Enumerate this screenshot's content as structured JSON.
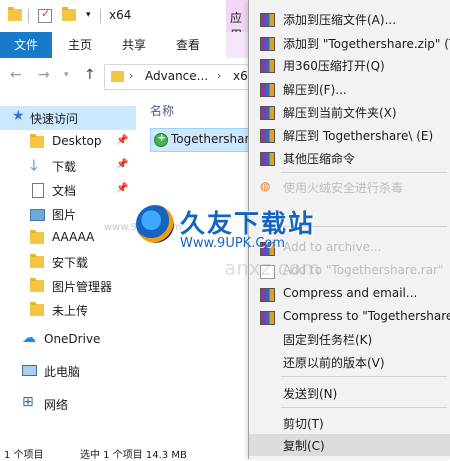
{
  "explorer": {
    "title": "x64",
    "app_tab_label": "应用",
    "ribbon_tabs": [
      "文件",
      "主页",
      "共享",
      "查看"
    ],
    "address": [
      "Advance...",
      "x6"
    ],
    "column_header": "名称",
    "nav_items": [
      {
        "label": "快速访问",
        "icon": "star-icon"
      },
      {
        "label": "Desktop",
        "icon": "folder-icon",
        "pinned": true
      },
      {
        "label": "下载",
        "icon": "download-icon",
        "pinned": true
      },
      {
        "label": "文档",
        "icon": "document-icon",
        "pinned": true
      },
      {
        "label": "图片",
        "icon": "picture-icon"
      },
      {
        "label": "AAAAA",
        "icon": "folder-icon"
      },
      {
        "label": "安下载",
        "icon": "folder-icon"
      },
      {
        "label": "图片管理器",
        "icon": "folder-icon"
      },
      {
        "label": "未上传",
        "icon": "folder-icon"
      },
      {
        "label": "OneDrive",
        "icon": "cloud-icon"
      },
      {
        "label": "此电脑",
        "icon": "computer-icon"
      },
      {
        "label": "网络",
        "icon": "network-icon"
      }
    ],
    "file": {
      "name": "Togethershare"
    },
    "status": {
      "count": "1 个项目",
      "selection": "选中 1 个项目  14.3 MB"
    }
  },
  "context_menu": {
    "items": [
      {
        "label": "添加到压缩文件(A)...",
        "icon": "winrar-icon"
      },
      {
        "label": "添加到 \"Togethershare.zip\" (T)",
        "icon": "winrar-icon"
      },
      {
        "label": "用360压缩打开(Q)",
        "icon": "winrar-icon"
      },
      {
        "label": "解压到(F)...",
        "icon": "winrar-icon"
      },
      {
        "label": "解压到当前文件夹(X)",
        "icon": "winrar-icon"
      },
      {
        "label": "解压到 Togethershare\\ (E)",
        "icon": "winrar-icon"
      },
      {
        "label": "其他压缩命令",
        "icon": "winrar-icon"
      },
      {
        "label": "使用火绒安全进行杀毒",
        "icon": "shield-icon",
        "dim": true
      },
      {
        "label": "Add to archive...",
        "icon": "winrar-icon",
        "dim": true
      },
      {
        "label": "Add to \"Togethershare.rar\"",
        "icon": "blank-icon",
        "dim": true
      },
      {
        "label": "Compress and email...",
        "icon": "winrar-icon"
      },
      {
        "label": "Compress to \"Togethershare",
        "icon": "winrar-icon"
      },
      {
        "label": "固定到任务栏(K)",
        "icon": "none"
      },
      {
        "label": "还原以前的版本(V)",
        "icon": "none"
      },
      {
        "label": "发送到(N)",
        "icon": "none"
      },
      {
        "label": "剪切(T)",
        "icon": "none"
      },
      {
        "label": "复制(C)",
        "icon": "none",
        "highlight": true
      }
    ]
  },
  "watermark": {
    "title": "久友下载站",
    "url": "Www.9UPK.Com",
    "left_text": "www.9UPK.com",
    "faint_text": "anxz.com"
  }
}
